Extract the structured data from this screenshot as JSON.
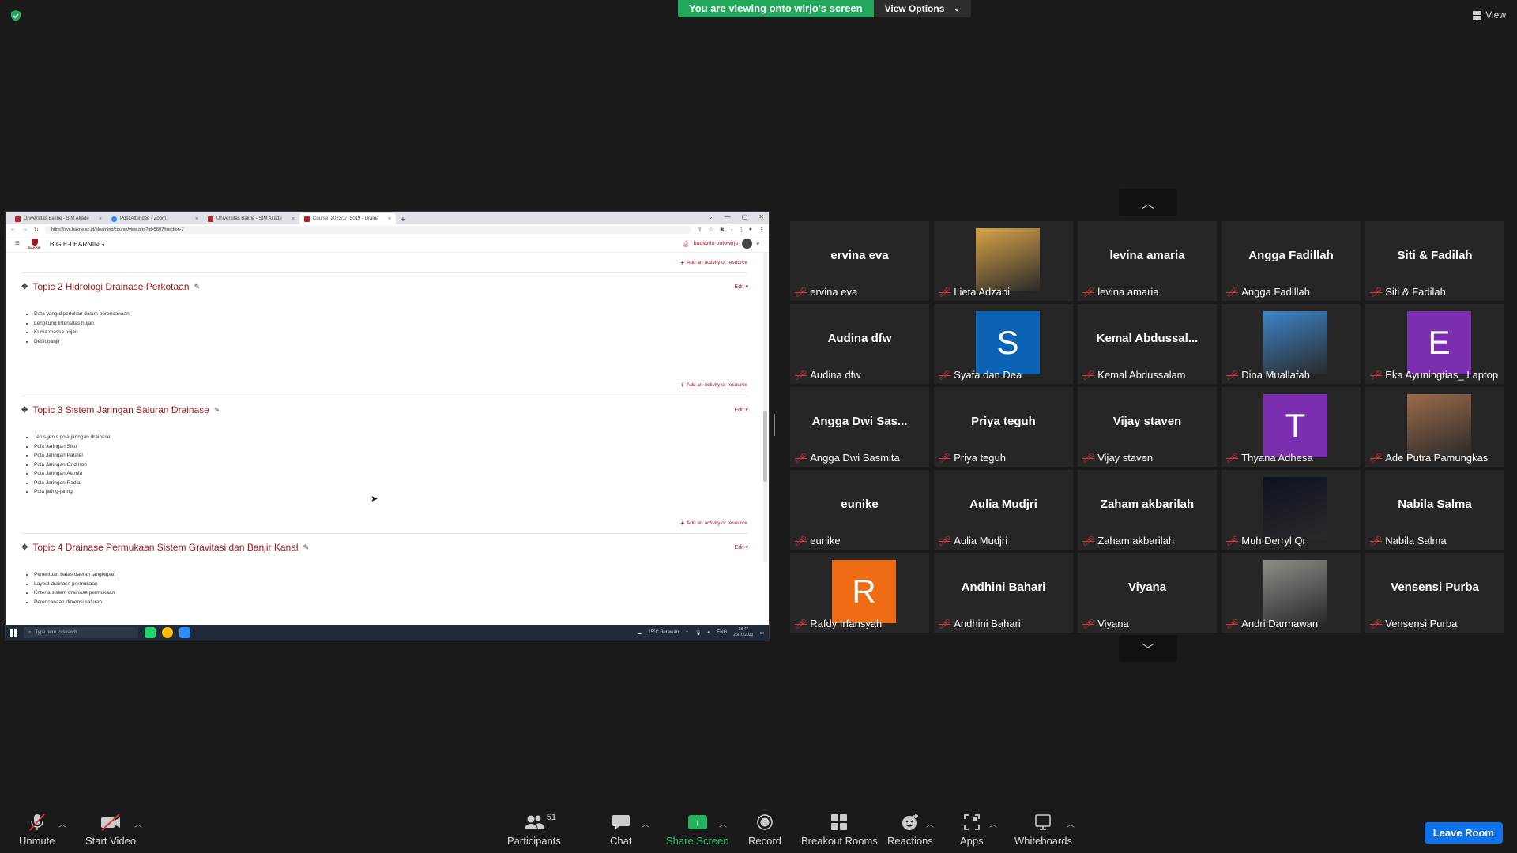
{
  "banner": {
    "viewing": "You are viewing onto wirjo's screen",
    "view_options": "View Options"
  },
  "top_right": {
    "view": "View"
  },
  "shared_screen": {
    "tabs": [
      {
        "label": "Universitas Bakrie - SIM Akade"
      },
      {
        "label": "Post Attendee - Zoom"
      },
      {
        "label": "Universitas Bakrie - SIM Akade"
      },
      {
        "label": "Course: 2023/1/TS019 - Draina"
      }
    ],
    "url": "https://svc.bakrie.ac.id/elearning/course/view.php?id=5607#section-7",
    "logo_word": "BAKRIE",
    "site_name": "BIG E-LEARNING",
    "user_name": "budianto ontowirjo",
    "add_activity": "Add an activity or resource",
    "edit": "Edit",
    "topics": [
      {
        "title": "Topic 2 Hidrologi Drainase Perkotaan",
        "items": [
          "Data yang diperlukan dalam perencanaan",
          "Lengkung Intensitas hujan",
          "Kurva massa hujan",
          "Debit banjir"
        ]
      },
      {
        "title": "Topic 3 Sistem Jaringan Saluran Drainase",
        "items": [
          "Jenis-jenis pola jaringan drainase",
          "Pola Jaringan Siku",
          "Pola Jaringan Paralel",
          "Pola Jaringan Grid Iron",
          "Pola Jaringan Alamia",
          "Pola Jaringan Radial",
          "Pola jaring-jaring"
        ]
      },
      {
        "title": "Topic 4 Drainase Permukaan Sistem Gravitasi dan Banjir Kanal",
        "items": [
          "Penentuan batas daerah tangkapan",
          "Layout drainase permukaan",
          "Kriteria sistem drainase permukaan",
          "Perencanaan dimensi saluran"
        ]
      }
    ],
    "taskbar": {
      "search": "Type here to search",
      "weather": "15°C Berawan",
      "lang": "ENG",
      "time": "18:47",
      "date": "26/10/2023"
    }
  },
  "participants": [
    {
      "big": "ervina eva",
      "label": "ervina eva",
      "kind": "name"
    },
    {
      "big": "",
      "label": "Lieta Adzani",
      "kind": "photo",
      "color": "#d9a347"
    },
    {
      "big": "levina amaria",
      "label": "levina amaria",
      "kind": "name"
    },
    {
      "big": "Angga Fadillah",
      "label": "Angga Fadillah",
      "kind": "name"
    },
    {
      "big": "Siti & Fadilah",
      "label": "Siti & Fadilah",
      "kind": "name"
    },
    {
      "big": "Audina dfw",
      "label": "Audina dfw",
      "kind": "name"
    },
    {
      "big": "S",
      "label": "Syafa dan Dea",
      "kind": "letter",
      "color": "#0c62b5"
    },
    {
      "big": "Kemal  Abdussal...",
      "label": "Kemal Abdussalam",
      "kind": "name"
    },
    {
      "big": "",
      "label": "Dina Muallafah",
      "kind": "photo",
      "color": "#3b84c9"
    },
    {
      "big": "E",
      "label": "Eka Ayuningtias_ Laptop",
      "kind": "letter",
      "color": "#7b2fb0"
    },
    {
      "big": "Angga  Dwi  Sas...",
      "label": "Angga Dwi Sasmita",
      "kind": "name"
    },
    {
      "big": "Priya teguh",
      "label": "Priya teguh",
      "kind": "name"
    },
    {
      "big": "Vijay staven",
      "label": "Vijay staven",
      "kind": "name"
    },
    {
      "big": "T",
      "label": "Thyana Adhesa",
      "kind": "letter",
      "color": "#7b2fb0"
    },
    {
      "big": "",
      "label": "Ade Putra Pamungkas",
      "kind": "photo",
      "color": "#9b6b4a"
    },
    {
      "big": "eunike",
      "label": "eunike",
      "kind": "name"
    },
    {
      "big": "Aulia Mudjri",
      "label": "Aulia Mudjri",
      "kind": "name"
    },
    {
      "big": "Zaham akbarilah",
      "label": "Zaham akbarilah",
      "kind": "name"
    },
    {
      "big": "",
      "label": "Muh Derryl Qr",
      "kind": "photo",
      "color": "#0d1220"
    },
    {
      "big": "Nabila Salma",
      "label": "Nabila Salma",
      "kind": "name"
    },
    {
      "big": "R",
      "label": "Rafdy Irfansyah",
      "kind": "letter",
      "color": "#ef6c14"
    },
    {
      "big": "Andhini Bahari",
      "label": "Andhini Bahari",
      "kind": "name"
    },
    {
      "big": "Viyana",
      "label": "Viyana",
      "kind": "name"
    },
    {
      "big": "",
      "label": "Andri Darmawan",
      "kind": "photo",
      "color": "#8a8f86"
    },
    {
      "big": "Vensensi Purba",
      "label": "Vensensi Purba",
      "kind": "name"
    }
  ],
  "toolbar": {
    "unmute": "Unmute",
    "start_video": "Start Video",
    "participants": "Participants",
    "participants_count": "51",
    "chat": "Chat",
    "share_screen": "Share Screen",
    "record": "Record",
    "breakout": "Breakout Rooms",
    "reactions": "Reactions",
    "apps": "Apps",
    "whiteboards": "Whiteboards",
    "leave": "Leave Room"
  },
  "colors": {
    "brand_red": "#a1181d",
    "banner_green": "#23a75a",
    "leave_blue": "#0e72ed",
    "mic_off": "#e0323c"
  }
}
